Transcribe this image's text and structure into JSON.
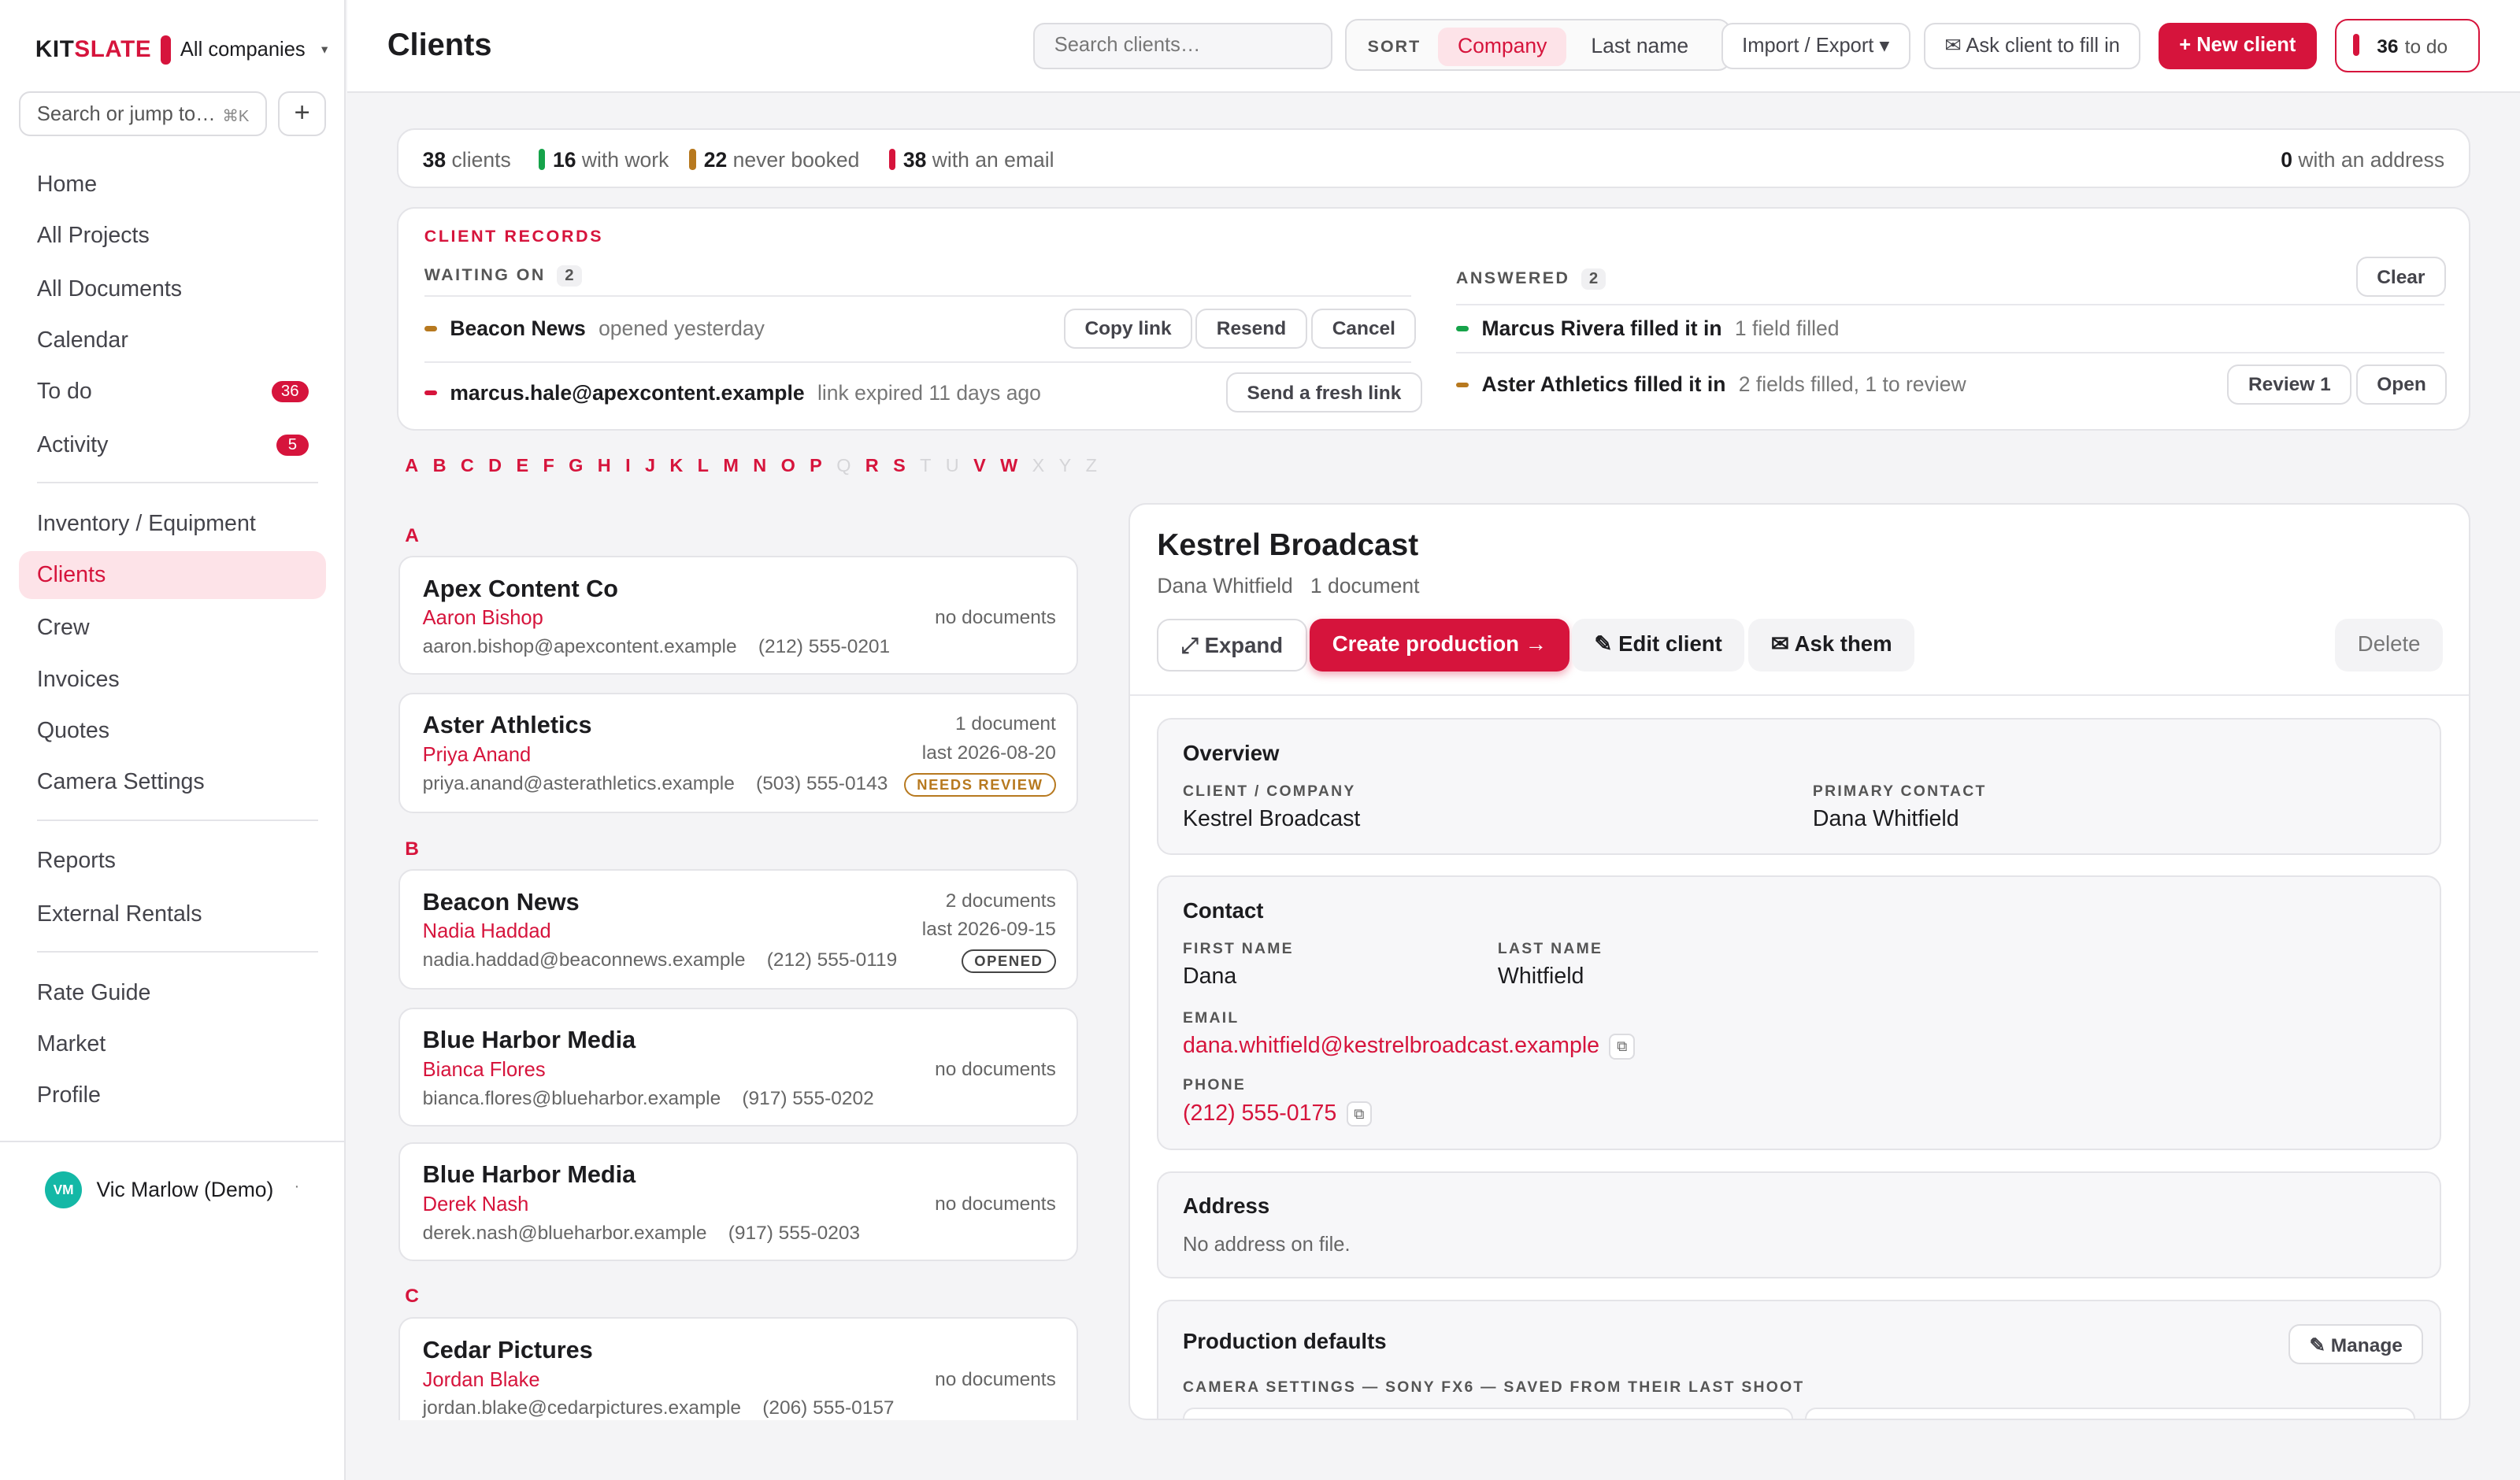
{
  "sidebar": {
    "brand_prefix": "KIT",
    "brand_suffix": "SLATE",
    "company": "All companies",
    "jump_placeholder": "Search or jump to…",
    "jump_shortcut": "⌘K",
    "add_label": "+",
    "items": [
      {
        "label": "Home"
      },
      {
        "label": "All Projects"
      },
      {
        "label": "All Documents"
      },
      {
        "label": "Calendar"
      },
      {
        "label": "To do",
        "badge": "36"
      },
      {
        "label": "Activity",
        "badge": "5"
      },
      {
        "label": "Inventory / Equipment"
      },
      {
        "label": "Clients"
      },
      {
        "label": "Crew"
      },
      {
        "label": "Invoices"
      },
      {
        "label": "Quotes"
      },
      {
        "label": "Camera Settings"
      },
      {
        "label": "Reports"
      },
      {
        "label": "External Rentals"
      },
      {
        "label": "Rate Guide"
      },
      {
        "label": "Market"
      },
      {
        "label": "Profile"
      }
    ],
    "user": {
      "initials": "VM",
      "name": "Vic Marlow (Demo)",
      "more": "·"
    }
  },
  "header": {
    "title": "Clients",
    "search_placeholder": "Search clients…",
    "sort_label": "SORT",
    "sort_options": [
      "Company",
      "Last name"
    ],
    "import_export": "Import / Export ▾",
    "ask_client": "✉ Ask client to fill in",
    "new_client": "+ New client",
    "todo_count": "36",
    "todo_label": "to do"
  },
  "stats": {
    "clients_n": "38",
    "clients_l": "clients",
    "work_n": "16",
    "work_l": "with work",
    "never_n": "22",
    "never_l": "never booked",
    "email_n": "38",
    "email_l": "with an email",
    "address_n": "0",
    "address_l": "with an address"
  },
  "records": {
    "title": "CLIENT RECORDS",
    "waiting_label": "WAITING ON",
    "waiting_count": "2",
    "answered_label": "ANSWERED",
    "answered_count": "2",
    "clear": "Clear",
    "waiting": [
      {
        "name": "Beacon News",
        "status": "opened yesterday",
        "actions": [
          "Copy link",
          "Resend",
          "Cancel"
        ]
      },
      {
        "name": "marcus.hale@apexcontent.example",
        "status": "link expired 11 days ago",
        "actions": [
          "Send a fresh link"
        ]
      }
    ],
    "answered": [
      {
        "name": "Marcus Rivera filled it in",
        "status": "1 field filled"
      },
      {
        "name": "Aster Athletics filled it in",
        "status": "2 fields filled, 1 to review",
        "actions": [
          "Review 1",
          "Open"
        ]
      }
    ]
  },
  "alphabet": [
    {
      "l": "A",
      "on": true
    },
    {
      "l": "B",
      "on": true
    },
    {
      "l": "C",
      "on": true
    },
    {
      "l": "D",
      "on": true
    },
    {
      "l": "E",
      "on": true
    },
    {
      "l": "F",
      "on": true
    },
    {
      "l": "G",
      "on": true
    },
    {
      "l": "H",
      "on": true
    },
    {
      "l": "I",
      "on": true
    },
    {
      "l": "J",
      "on": true
    },
    {
      "l": "K",
      "on": true
    },
    {
      "l": "L",
      "on": true
    },
    {
      "l": "M",
      "on": true
    },
    {
      "l": "N",
      "on": true
    },
    {
      "l": "O",
      "on": true
    },
    {
      "l": "P",
      "on": true
    },
    {
      "l": "Q",
      "on": false
    },
    {
      "l": "R",
      "on": true
    },
    {
      "l": "S",
      "on": true
    },
    {
      "l": "T",
      "on": false
    },
    {
      "l": "U",
      "on": false
    },
    {
      "l": "V",
      "on": true
    },
    {
      "l": "W",
      "on": true
    },
    {
      "l": "X",
      "on": false
    },
    {
      "l": "Y",
      "on": false
    },
    {
      "l": "Z",
      "on": false
    }
  ],
  "clients": {
    "groups": [
      "A",
      "B",
      "C"
    ],
    "list": [
      {
        "name": "Apex Content Co",
        "contact": "Aaron Bishop",
        "email": "aaron.bishop@apexcontent.example",
        "phone": "(212) 555-0201",
        "docs": "no documents"
      },
      {
        "name": "Aster Athletics",
        "contact": "Priya Anand",
        "email": "priya.anand@asterathletics.example",
        "phone": "(503) 555-0143",
        "docs": "1 document",
        "last": "last 2026-08-20",
        "badge": "NEEDS REVIEW"
      },
      {
        "name": "Beacon News",
        "contact": "Nadia Haddad",
        "email": "nadia.haddad@beaconnews.example",
        "phone": "(212) 555-0119",
        "docs": "2 documents",
        "last": "last 2026-09-15",
        "badge": "OPENED"
      },
      {
        "name": "Blue Harbor Media",
        "contact": "Bianca Flores",
        "email": "bianca.flores@blueharbor.example",
        "phone": "(917) 555-0202",
        "docs": "no documents"
      },
      {
        "name": "Blue Harbor Media",
        "contact": "Derek Nash",
        "email": "derek.nash@blueharbor.example",
        "phone": "(917) 555-0203",
        "docs": "no documents"
      },
      {
        "name": "Cedar Pictures",
        "contact": "Jordan Blake",
        "email": "jordan.blake@cedarpictures.example",
        "phone": "(206) 555-0157",
        "docs": "no documents"
      }
    ]
  },
  "detail": {
    "name": "Kestrel Broadcast",
    "meta_contact": "Dana Whitfield",
    "meta_docs": "1 document",
    "expand": "⤢ Expand",
    "create": "Create production →",
    "edit": "✎ Edit client",
    "ask": "✉ Ask them",
    "delete": "Delete",
    "overview": {
      "title": "Overview",
      "company_label": "CLIENT / COMPANY",
      "company": "Kestrel Broadcast",
      "primary_label": "PRIMARY CONTACT",
      "primary": "Dana Whitfield"
    },
    "contact": {
      "title": "Contact",
      "first_label": "FIRST NAME",
      "first": "Dana",
      "last_label": "LAST NAME",
      "last": "Whitfield",
      "email_label": "EMAIL",
      "email": "dana.whitfield@kestrelbroadcast.example",
      "phone_label": "PHONE",
      "phone": "(212) 555-0175",
      "copy": "⧉"
    },
    "address": {
      "title": "Address",
      "empty": "No address on file."
    },
    "production": {
      "title": "Production defaults",
      "manage": "✎ Manage",
      "camera_label": "CAMERA SETTINGS — SONY FX6 — SAVED FROM THEIR LAST SHOOT"
    }
  },
  "colors": {
    "accent": "#d6143c",
    "green": "#16a34a",
    "amber": "#b7791f"
  }
}
